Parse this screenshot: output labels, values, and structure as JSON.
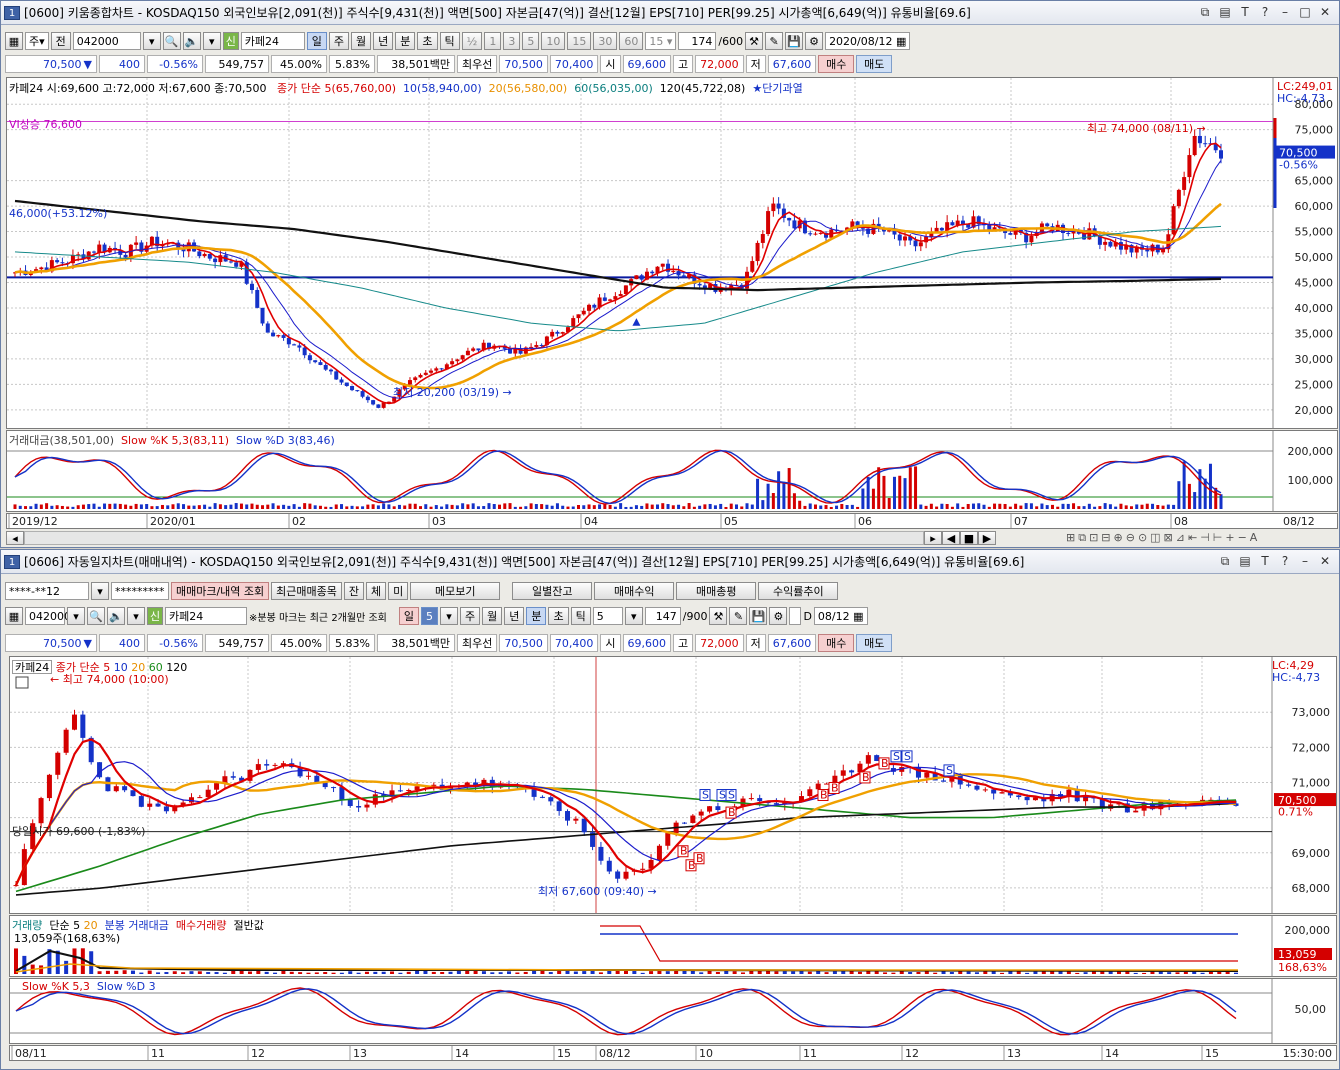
{
  "win1": {
    "title": "[0600] 키움종합차트 - KOSDAQ150 외국인보유[2,091(천)] 주식수[9,431(천)] 액면[500] 자본금[47(억)] 결산[12월] EPS[710] PER[99.25] 시가총액[6,649(억)] 유통비율[69.6]",
    "code": "042000",
    "dir": "주",
    "period_label": "전",
    "stock_name": "카페24",
    "period_tabs": [
      "일",
      "주",
      "월",
      "년",
      "분",
      "초",
      "틱"
    ],
    "interval_buttons": [
      "½",
      "1",
      "3",
      "5",
      "10",
      "15",
      "30",
      "60"
    ],
    "interval_sel": "15",
    "count": "174",
    "count_total": "/600",
    "date": "2020/08/12",
    "quote": {
      "price": "70,500",
      "change": "400",
      "rate": "-0.56%",
      "volume": "549,757",
      "v1": "45.00%",
      "v2": "5.83%",
      "amount": "38,501백만",
      "best_label": "최우선",
      "ask": "70,500",
      "bid": "70,400",
      "open_label": "시",
      "open": "69,600",
      "high_label": "고",
      "high": "72,000",
      "low_label": "저",
      "low": "67,600",
      "buy": "매수",
      "sell": "매도"
    },
    "legend": {
      "title": "카페24 시:69,600 고:72,000 저:67,600 종:70,500",
      "ma_label": "종가 단순",
      "ma5": "5(65,760,00)",
      "ma10": "10(58,940,00)",
      "ma20": "20(56,580,00)",
      "ma60": "60(56,035,00)",
      "ma120": "120(45,722,08)",
      "signal": "★단기과열"
    },
    "vi_label": "VI상승 76,600",
    "high_note": "최고 74,000 (08/11)",
    "low_note": "최저 20,200 (03/19)",
    "line_note": "46,000(+53.12%)",
    "y_labels": [
      "80,000",
      "75,000",
      "70,500",
      "65,000",
      "60,000",
      "55,000",
      "50,000",
      "45,000",
      "40,000",
      "35,000",
      "30,000",
      "25,000",
      "20,000"
    ],
    "lc": "LC:249,01",
    "hc": "HC:-4,73",
    "cur_price": "70,500",
    "cur_rate": "-0.56%",
    "sub_legend": {
      "amount": "거래대금(38,501,00)",
      "k": "Slow %K 5,3(83,11)",
      "d": "Slow %D 3(83,46)"
    },
    "sub_y": [
      "200,000",
      "100,000"
    ],
    "x_labels": [
      "2019/12",
      "2020/01",
      "02",
      "03",
      "04",
      "05",
      "06",
      "07",
      "08"
    ],
    "x_end": "08/12"
  },
  "win2": {
    "title": "[0606] 자동일지차트(매매내역) - KOSDAQ150 외국인보유[2,091(천)] 주식수[9,431(천)] 액면[500] 자본금[47(억)] 결산[12월] EPS[710] PER[99.25] 시가총액[6,649(억)] 유통비율[69.6]",
    "account": "****-**12",
    "password": "*********",
    "buttons": [
      "매매마크/내역 조회",
      "최근매매종목",
      "잔",
      "체",
      "미",
      "메모보기",
      "일별잔고",
      "매매수익",
      "매매총평",
      "수익률추이"
    ],
    "code": "042000",
    "stock_name": "카페24",
    "note": "※분봉 마크는 최근 2개월만 조회",
    "period_tabs": [
      "일",
      "5",
      "주",
      "월",
      "년",
      "분",
      "초",
      "틱"
    ],
    "interval": "5",
    "count": "147",
    "count_total": "/900",
    "date": "08/12",
    "quote": {
      "price": "70,500",
      "change": "400",
      "rate": "-0.56%",
      "volume": "549,757",
      "v1": "45.00%",
      "v2": "5.83%",
      "amount": "38,501백만",
      "best_label": "최우선",
      "ask": "70,500",
      "bid": "70,400",
      "open_label": "시",
      "open": "69,600",
      "high_label": "고",
      "high": "72,000",
      "low_label": "저",
      "low": "67,600",
      "buy": "매수",
      "sell": "매도"
    },
    "legend": {
      "name": "카페24",
      "ma_label": "종가 단순",
      "ma5": "5",
      "ma10": "10",
      "ma20": "20",
      "ma60": "60",
      "ma120": "120"
    },
    "high_note": "최고 74,000 (10:00)",
    "low_note": "최저 67,600 (09:40)",
    "open_note": "당일시가 69,600 (-1,83%)",
    "y_labels": [
      "73,000",
      "72,000",
      "71,000",
      "70,500",
      "69,000",
      "68,000"
    ],
    "lc": "LC:4,29",
    "hc": "HC:-4,73",
    "cur_price": "70,500",
    "cur_rate": "0.71%",
    "vol_legend": {
      "vol": "거래량",
      "ma": "단순 5",
      "ma20": "20",
      "amt": "분봉 거래대금",
      "buy": "매수거래량",
      "half": "절반값"
    },
    "vol_note": "13,059주(168,63%)",
    "vol_y": "200,000",
    "vol_cur": "13,059",
    "vol_rate": "168,63%",
    "stoch_legend": {
      "k": "Slow %K 5,3",
      "d": "Slow %D 3"
    },
    "stoch_y": "50,00",
    "x_labels": [
      "08/11",
      "11",
      "12",
      "13",
      "14",
      "15",
      "08/12",
      "10",
      "11",
      "12",
      "13",
      "14",
      "15"
    ],
    "x_end": "15:30:00"
  },
  "colors": {
    "up": "#d40000",
    "down": "#1432c8",
    "ma5": "#e00000",
    "ma10": "#1c1ccc",
    "ma20": "#f0a000",
    "ma60": "#168a8a",
    "ma120": "#111111",
    "green": "#1a8a1a"
  }
}
